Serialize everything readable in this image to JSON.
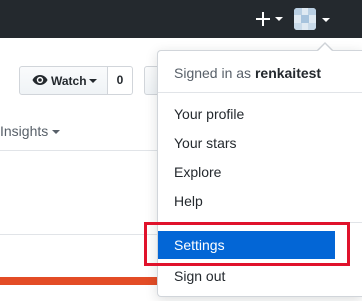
{
  "header": {
    "plus_label": "+",
    "avatar_alt": "renkaitest avatar"
  },
  "repo_actions": {
    "watch_label": "Watch",
    "watch_count": "0"
  },
  "nav": {
    "insights_label": "Insights"
  },
  "user_menu": {
    "signed_in_prefix": "Signed in as",
    "username": "renkaitest",
    "items": [
      {
        "label": "Your profile"
      },
      {
        "label": "Your stars"
      },
      {
        "label": "Explore"
      },
      {
        "label": "Help"
      },
      {
        "label": "Settings"
      },
      {
        "label": "Sign out"
      }
    ],
    "active_item": "Settings"
  },
  "colors": {
    "header_bg": "#24292e",
    "menu_active_bg": "#0366d6",
    "highlight_border": "#e0122b",
    "language_bar": "#e34c26"
  },
  "icons": {
    "plus": "plus-icon",
    "caret": "caret-down-icon",
    "eye": "eye-icon"
  }
}
